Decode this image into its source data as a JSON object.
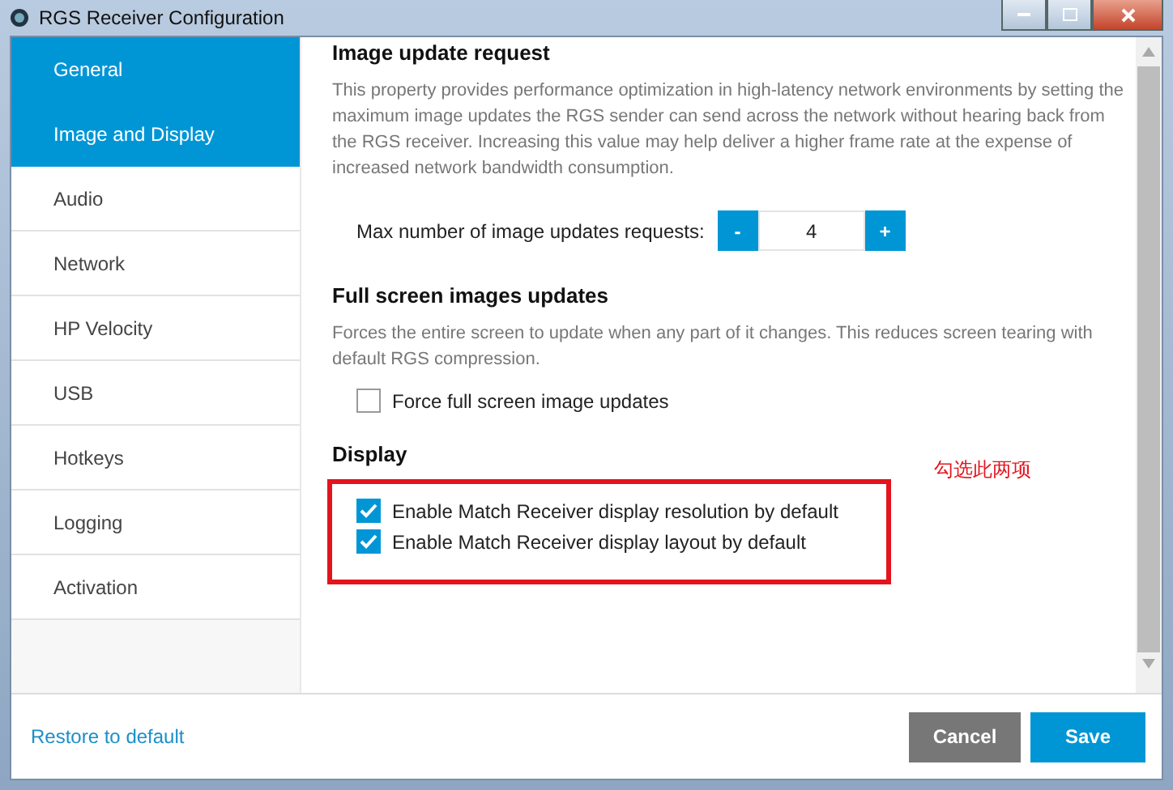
{
  "window": {
    "title": "RGS Receiver Configuration"
  },
  "sidebar": {
    "items": [
      {
        "label": "General",
        "selected": true
      },
      {
        "label": "Image and Display",
        "selected": true
      },
      {
        "label": "Audio",
        "selected": false
      },
      {
        "label": "Network",
        "selected": false
      },
      {
        "label": "HP Velocity",
        "selected": false
      },
      {
        "label": "USB",
        "selected": false
      },
      {
        "label": "Hotkeys",
        "selected": false
      },
      {
        "label": "Logging",
        "selected": false
      },
      {
        "label": "Activation",
        "selected": false
      }
    ]
  },
  "sections": [
    {
      "kind": "stepper",
      "title": "Image update request",
      "description": "This property provides performance optimization in high-latency network environments by setting the maximum image updates the RGS sender can send across the network without hearing back from the RGS receiver. Increasing this value may help deliver a higher frame rate at the expense of increased network bandwidth consumption.",
      "label": "Max number of image updates requests:",
      "decrement": "-",
      "value": "4",
      "increment": "+"
    },
    {
      "kind": "checkboxes",
      "title": "Full screen images updates",
      "description": "Forces the entire screen to update when any part of it changes. This reduces screen tearing with default RGS compression.",
      "options": [
        {
          "label": "Force full screen image updates",
          "checked": false
        }
      ]
    },
    {
      "kind": "checkboxes",
      "title": "Display",
      "annotated": true,
      "options": [
        {
          "label": "Enable Match Receiver display resolution by default",
          "checked": true
        },
        {
          "label": "Enable Match Receiver display layout by default",
          "checked": true
        }
      ]
    }
  ],
  "annotation": {
    "text": "勾选此两项"
  },
  "footer": {
    "restore_link": "Restore to default",
    "buttons": [
      {
        "label": "Cancel",
        "kind": "secondary"
      },
      {
        "label": "Save",
        "kind": "primary"
      }
    ]
  }
}
